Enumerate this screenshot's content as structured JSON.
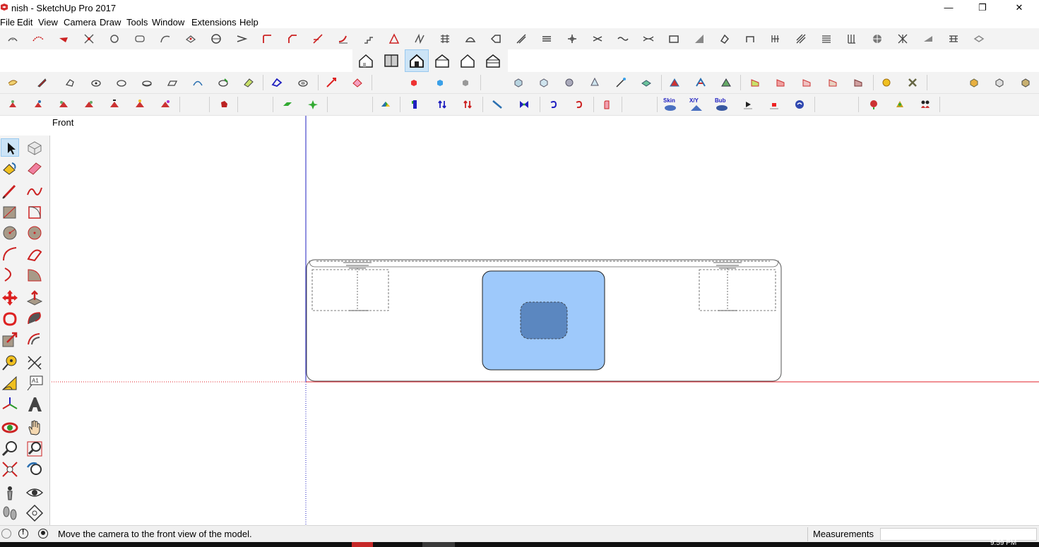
{
  "window": {
    "title": "nish - SketchUp Pro 2017",
    "minimize_glyph": "—",
    "maximize_glyph": "❐",
    "close_glyph": "✕"
  },
  "menu": [
    "File",
    "Edit",
    "View",
    "Camera",
    "Draw",
    "Tools",
    "Window",
    "Extensions",
    "Help"
  ],
  "toolbar_text_icons": {
    "skin": "Skin",
    "xy": "X/Y",
    "bub": "Bub"
  },
  "viewport": {
    "scene_label": "Front"
  },
  "status": {
    "message": "Move the camera to the front view of the model.",
    "measurements_label": "Measurements",
    "measurements_value": ""
  },
  "taskbar": {
    "clock": "9:59 PM"
  },
  "colors": {
    "outer_fill": "#9ec9fb",
    "inner_fill": "#5b87c0",
    "red_axis": "#e0202a",
    "green_axis": "#2a9a2a",
    "blue_axis": "#2020c0",
    "selection_bg": "#cce4f7"
  }
}
